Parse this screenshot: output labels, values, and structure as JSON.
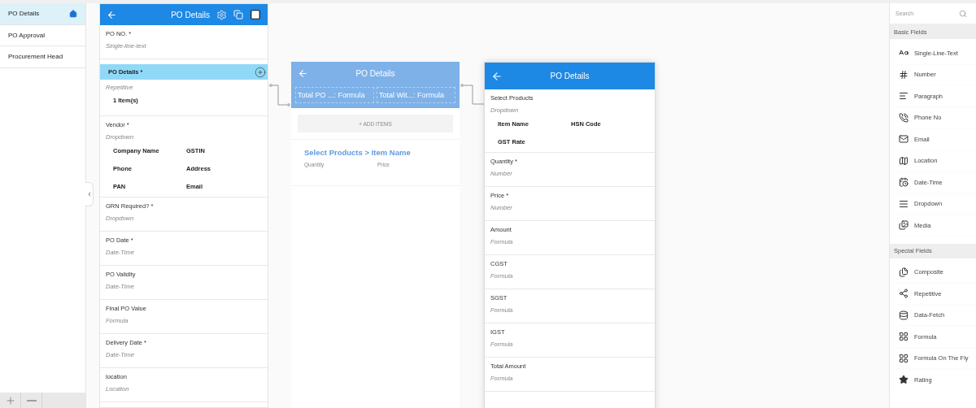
{
  "sidebar": {
    "items": [
      {
        "label": "PO Details",
        "selected": true
      },
      {
        "label": "PO Approval",
        "selected": false
      },
      {
        "label": "Procurement Head",
        "selected": false
      }
    ]
  },
  "form": {
    "title": "PO Details",
    "fields": [
      {
        "label": "PO NO. *",
        "type": "Single-line-text",
        "selected": false
      },
      {
        "label": "PO Details *",
        "type": "Repetitive",
        "selected": true,
        "summary": "1 Item(s)"
      },
      {
        "label": "Vendor *",
        "type": "Dropdown",
        "selected": false,
        "subfields": [
          "Company Name",
          "GSTIN",
          "Phone",
          "Address",
          "PAN",
          "Email"
        ]
      },
      {
        "label": "GRN Required? *",
        "type": "Dropdown",
        "selected": false
      },
      {
        "label": "PO Date *",
        "type": "Date-Time",
        "selected": false
      },
      {
        "label": "PO Validity",
        "type": "Date-Time",
        "selected": false
      },
      {
        "label": "Final PO Value",
        "type": "Formula",
        "selected": false
      },
      {
        "label": "Delivery Date *",
        "type": "Date-Time",
        "selected": false
      },
      {
        "label": "location",
        "type": "Location",
        "selected": false
      }
    ]
  },
  "preview": {
    "title": "PO Details",
    "chips": [
      "Total PO ...: Formula",
      "Total Wit...: Formula"
    ],
    "add_button": "+ ADD ITEMS",
    "item_title": "Select Products > Item Name",
    "item_columns": [
      "Quantity",
      "Price"
    ]
  },
  "detail": {
    "title": "PO Details",
    "fields": [
      {
        "label": "Select Products",
        "type": "Dropdown",
        "subfields": [
          "Item Name",
          "HSN Code",
          "GST Rate"
        ]
      },
      {
        "label": "Quantity *",
        "type": "Number"
      },
      {
        "label": "Price *",
        "type": "Number"
      },
      {
        "label": "Amount",
        "type": "Formula"
      },
      {
        "label": "CGST",
        "type": "Formula"
      },
      {
        "label": "SGST",
        "type": "Formula"
      },
      {
        "label": "IGST",
        "type": "Formula"
      },
      {
        "label": "Total Amount",
        "type": "Formula"
      }
    ]
  },
  "palette": {
    "search": {
      "placeholder": "Search"
    },
    "sections": [
      {
        "title": "Basic Fields",
        "items": [
          {
            "label": "Single-Line-Text",
            "kind": "text"
          },
          {
            "label": "Number",
            "kind": "number"
          },
          {
            "label": "Paragraph",
            "kind": "paragraph"
          },
          {
            "label": "Phone No",
            "kind": "phone"
          },
          {
            "label": "Email",
            "kind": "email"
          },
          {
            "label": "Location",
            "kind": "location"
          },
          {
            "label": "Date-Time",
            "kind": "datetime"
          },
          {
            "label": "Dropdown",
            "kind": "dropdown"
          },
          {
            "label": "Media",
            "kind": "media"
          }
        ]
      },
      {
        "title": "Special Fields",
        "items": [
          {
            "label": "Composite",
            "kind": "composite"
          },
          {
            "label": "Repetitive",
            "kind": "repetitive"
          },
          {
            "label": "Data-Fetch",
            "kind": "datafetch"
          },
          {
            "label": "Formula",
            "kind": "formula"
          },
          {
            "label": "Formula On The Fly",
            "kind": "formula"
          },
          {
            "label": "Rating",
            "kind": "rating"
          }
        ]
      }
    ]
  }
}
